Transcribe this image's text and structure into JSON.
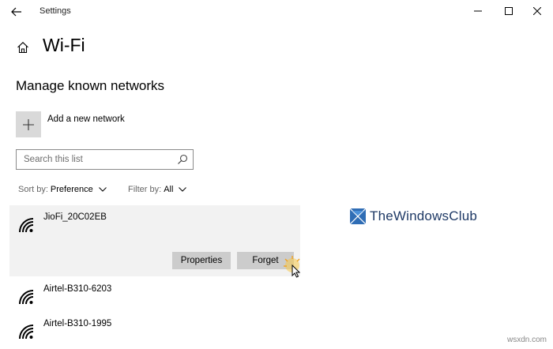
{
  "window": {
    "title": "Settings",
    "controls": {
      "minimize_icon": "minimize-icon",
      "maximize_icon": "maximize-icon",
      "close_icon": "close-icon"
    }
  },
  "page": {
    "title": "Wi-Fi",
    "section_heading": "Manage known networks"
  },
  "add_network": {
    "label": "Add a new network",
    "icon": "plus-icon"
  },
  "search": {
    "placeholder": "Search this list",
    "value": ""
  },
  "sort": {
    "label": "Sort by:",
    "value": "Preference"
  },
  "filter": {
    "label": "Filter by:",
    "value": "All"
  },
  "networks": [
    {
      "name": "JioFi_20C02EB",
      "selected": true
    },
    {
      "name": "Airtel-B310-6203",
      "selected": false
    },
    {
      "name": "Airtel-B310-1995",
      "selected": false
    }
  ],
  "selected_actions": {
    "properties_label": "Properties",
    "forget_label": "Forget"
  },
  "watermark": {
    "brand": "TheWindowsClub",
    "site": "wsxdn.com"
  },
  "colors": {
    "selected_row_bg": "#f2f2f2",
    "button_bg": "#cccccc",
    "add_tile_bg": "#d9d9d9",
    "brand_blue": "#1f3a66"
  }
}
